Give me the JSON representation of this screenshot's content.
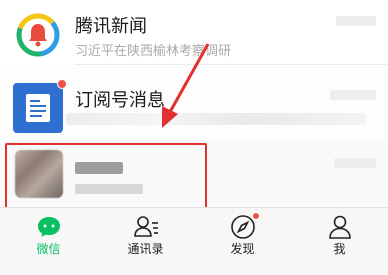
{
  "chats": [
    {
      "title": "腾讯新闻",
      "subtitle": "习近平在陕西榆林考察调研"
    },
    {
      "title": "订阅号消息"
    },
    {
      "title": ""
    }
  ],
  "tabs": [
    {
      "label": "微信",
      "icon": "chat-bubble-icon",
      "active": true
    },
    {
      "label": "通讯录",
      "icon": "contacts-icon"
    },
    {
      "label": "发现",
      "icon": "compass-icon",
      "badge": true
    },
    {
      "label": "我",
      "icon": "person-icon"
    }
  ],
  "colors": {
    "accent": "#07c160",
    "badge": "#f04e4e",
    "annotation": "#e03030"
  }
}
